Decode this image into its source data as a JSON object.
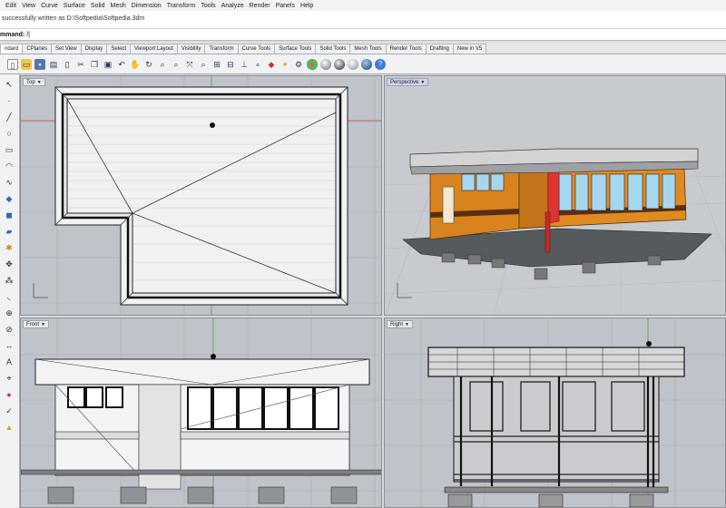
{
  "menu": [
    "Edit",
    "View",
    "Curve",
    "Surface",
    "Solid",
    "Mesh",
    "Dimension",
    "Transform",
    "Tools",
    "Analyze",
    "Render",
    "Panels",
    "Help"
  ],
  "history": "successfully written as D:\\Softpedia\\Softpedia.3dm",
  "command": {
    "label": "mmand:",
    "value": "/|"
  },
  "tabs": [
    {
      "label": "ndard",
      "active": true
    },
    {
      "label": "CPlanes"
    },
    {
      "label": "Set View"
    },
    {
      "label": "Display"
    },
    {
      "label": "Select"
    },
    {
      "label": "Viewport Layout"
    },
    {
      "label": "Visibility"
    },
    {
      "label": "Transform"
    },
    {
      "label": "Curve Tools"
    },
    {
      "label": "Surface Tools"
    },
    {
      "label": "Solid Tools"
    },
    {
      "label": "Mesh Tools"
    },
    {
      "label": "Render Tools"
    },
    {
      "label": "Drafting"
    },
    {
      "label": "New in V5"
    }
  ],
  "toolbar_icons": [
    "new-icon",
    "open-icon",
    "save-icon",
    "print-icon",
    "import-icon",
    "cut-icon",
    "copy-icon",
    "paste-icon",
    "undo-icon",
    "pan-icon",
    "rotate-view-icon",
    "zoom-icon",
    "zoom-window-icon",
    "zoom-extents-icon",
    "zoom-selected-icon",
    "four-viewports-icon",
    "grid-icon",
    "cplane-icon",
    "point-icon",
    "layer-icon",
    "lightbulb-icon",
    "properties-icon",
    "color-wheel-icon",
    "render-icon",
    "sphere-icon",
    "material-icon",
    "globe-icon",
    "help-icon"
  ],
  "viewports": {
    "top": {
      "label": "Top"
    },
    "perspective": {
      "label": "Perspective"
    },
    "front": {
      "label": "Front"
    },
    "right": {
      "label": "Right"
    }
  }
}
